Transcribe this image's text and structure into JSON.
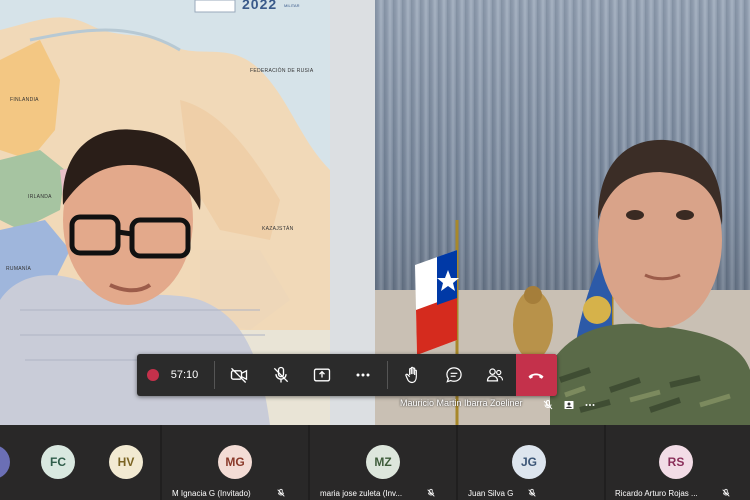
{
  "meeting": {
    "timer": "57:10",
    "map_year": "2022",
    "map_subtitle": "MILITAR",
    "map_labels": [
      "FEDERACIÓN DE RUSIA",
      "FINLANDIA",
      "KAZAJSTÁN",
      "RUMANÍA",
      "IRLANDA"
    ],
    "main_participant_right": "Mauricio Martin Ibarra Zoeliner"
  },
  "toolbar": {
    "items": [
      {
        "icon": "camera-off-icon"
      },
      {
        "icon": "mic-off-icon"
      },
      {
        "icon": "share-screen-icon"
      },
      {
        "icon": "more-options-icon"
      },
      {
        "icon": "raise-hand-icon"
      },
      {
        "icon": "chat-icon"
      },
      {
        "icon": "participants-icon"
      }
    ],
    "hangup_icon": "hang-up-icon",
    "colors": {
      "record": "#c4314b",
      "hangup": "#c4314b",
      "bar": "#2b2b2b"
    }
  },
  "participants": [
    {
      "initials": "FC",
      "name": "",
      "bg": "#d9e8e0",
      "fg": "#2f5d4a"
    },
    {
      "initials": "HV",
      "name": "",
      "bg": "#f2ead2",
      "fg": "#7a6423"
    },
    {
      "initials": "MG",
      "name": "M Ignacia G (Invitado)",
      "bg": "#f3dcd5",
      "fg": "#8a3a2a"
    },
    {
      "initials": "MZ",
      "name": "maria jose zuleta (Inv...",
      "bg": "#dde6dc",
      "fg": "#3f5d3b"
    },
    {
      "initials": "JG",
      "name": "Juan Silva G",
      "bg": "#dde5ee",
      "fg": "#3c5677"
    },
    {
      "initials": "RS",
      "name": "Ricardo Arturo Rojas ...",
      "bg": "#f2dce6",
      "fg": "#8a2f5a"
    }
  ]
}
